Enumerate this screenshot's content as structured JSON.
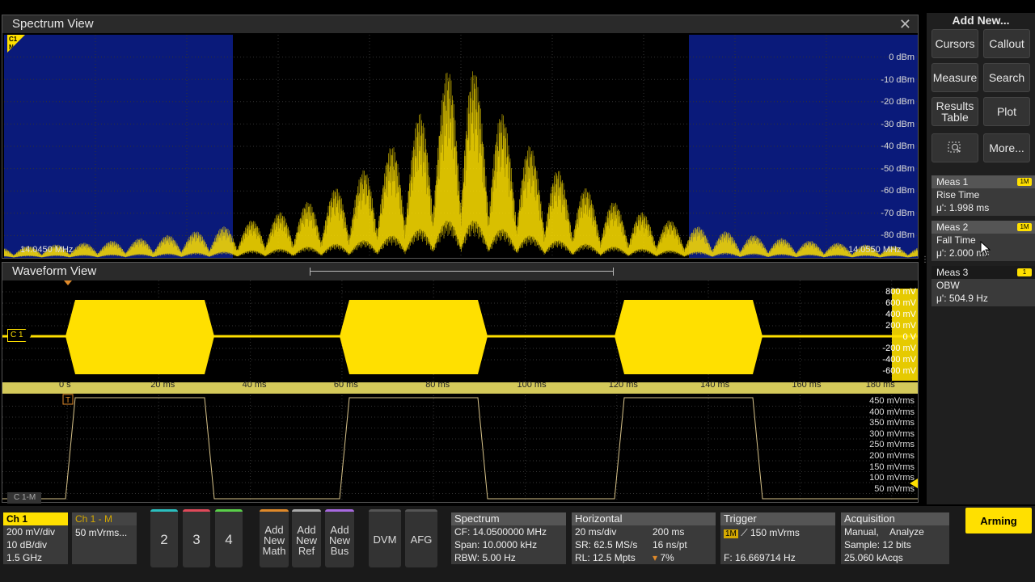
{
  "spectrum": {
    "title": "Spectrum View",
    "close_icon": "close-icon",
    "badge": "C1\nN",
    "dbm_labels": [
      "0 dBm",
      "-10 dBm",
      "-20 dBm",
      "-30 dBm",
      "-40 dBm",
      "-50 dBm",
      "-60 dBm",
      "-70 dBm",
      "-80 dBm"
    ],
    "freq_start": "14.0450 MHz",
    "freq_end": "14.0550 MHz",
    "colors": {
      "trace": "#ffe000",
      "outer_band": "#0a1a7a",
      "grid": "#3a3a5a"
    }
  },
  "waveform": {
    "title": "Waveform View",
    "c1_tag": "C 1",
    "c1m_tag": "C 1-M",
    "trigger_marker": "T",
    "y_labels_top": [
      "800 mV",
      "600 mV",
      "400 mV",
      "200 mV",
      "0 V",
      "-200 mV",
      "-400 mV",
      "-600 mV"
    ],
    "x_labels": [
      "0 s",
      "20 ms",
      "40 ms",
      "60 ms",
      "80 ms",
      "100 ms",
      "120 ms",
      "140 ms",
      "160 ms",
      "180 ms"
    ],
    "y_labels_math": [
      "450 mVrms",
      "400 mVrms",
      "350 mVrms",
      "300 mVrms",
      "250 mVrms",
      "200 mVrms",
      "150 mVrms",
      "100 mVrms",
      "50 mVrms"
    ]
  },
  "side": {
    "add_new": "Add New...",
    "buttons": [
      "Cursors",
      "Callout",
      "Measure",
      "Search",
      "Results Table",
      "Plot",
      "More..."
    ],
    "search_icon": "zoom-select-icon",
    "meas": [
      {
        "title": "Meas 1",
        "tag": "1M",
        "name": "Rise Time",
        "value": "μ': 1.998 ms"
      },
      {
        "title": "Meas 2",
        "tag": "1M",
        "name": "Fall Time",
        "value": "μ': 2.000 ms"
      },
      {
        "title": "Meas 3",
        "tag": "1",
        "name": "OBW",
        "value": "μ': 504.9 Hz"
      }
    ]
  },
  "bottom": {
    "ch1": {
      "title": "Ch 1",
      "rows": [
        "200 mV/div",
        "10 dB/div",
        "1.5 GHz"
      ]
    },
    "ch1m": {
      "title": "Ch 1 - M",
      "rows": [
        "50 mVrms..."
      ]
    },
    "channels": [
      "2",
      "3",
      "4"
    ],
    "add_buttons": [
      "Add New Math",
      "Add New Ref",
      "Add New Bus"
    ],
    "dvm": "DVM",
    "afg": "AFG",
    "spectrum": {
      "title": "Spectrum",
      "rows": [
        "CF: 14.0500000 MHz",
        "Span: 10.0000 kHz",
        "RBW: 5.00 Hz"
      ]
    },
    "horizontal": {
      "title": "Horizontal",
      "left": [
        "20 ms/div",
        "SR: 62.5 MS/s",
        "RL: 12.5 Mpts"
      ],
      "right": [
        "200 ms",
        "16 ns/pt",
        "7%"
      ]
    },
    "trigger": {
      "title": "Trigger",
      "tag": "1M",
      "level": "150 mVrms",
      "freq": "F: 16.669714 Hz"
    },
    "acquisition": {
      "title": "Acquisition",
      "rows": [
        "Manual,",
        "Sample: 12 bits",
        "25.060 kAcqs"
      ],
      "analyze": "Analyze"
    },
    "arming": "Arming"
  }
}
